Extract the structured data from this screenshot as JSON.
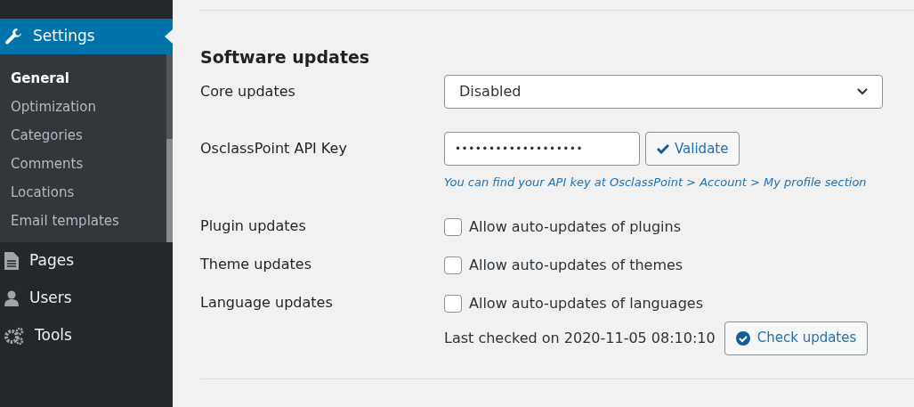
{
  "sidebar": {
    "items": [
      {
        "label": "Settings",
        "selected": true,
        "children": [
          {
            "label": "General",
            "selected": true
          },
          {
            "label": "Optimization",
            "selected": false
          },
          {
            "label": "Categories",
            "selected": false
          },
          {
            "label": "Comments",
            "selected": false
          },
          {
            "label": "Locations",
            "selected": false
          },
          {
            "label": "Email templates",
            "selected": false
          }
        ]
      },
      {
        "label": "Pages",
        "selected": false
      },
      {
        "label": "Users",
        "selected": false
      },
      {
        "label": "Tools",
        "selected": false
      }
    ]
  },
  "section": {
    "title": "Software updates",
    "rows": [
      {
        "kind": "select",
        "label": "Core updates",
        "value": "Disabled"
      },
      {
        "kind": "key",
        "label": "OsclassPoint API Key",
        "value": "•••••••••••••••••••",
        "button": "Validate",
        "help": "*You can find your API key at* OsclassPoint > Account > My profile *section*"
      },
      {
        "kind": "checkbox",
        "label": "Plugin updates",
        "text": "Allow auto-updates of plugins",
        "checked": false
      },
      {
        "kind": "checkbox",
        "label": "Theme updates",
        "text": "Allow auto-updates of themes",
        "checked": false
      },
      {
        "kind": "checkbox",
        "label": "Language updates",
        "text": "Allow auto-updates of languages",
        "checked": false
      }
    ],
    "last_checked": "Last checked on 2020-11-05 08:10:10",
    "check_button": "Check updates"
  }
}
